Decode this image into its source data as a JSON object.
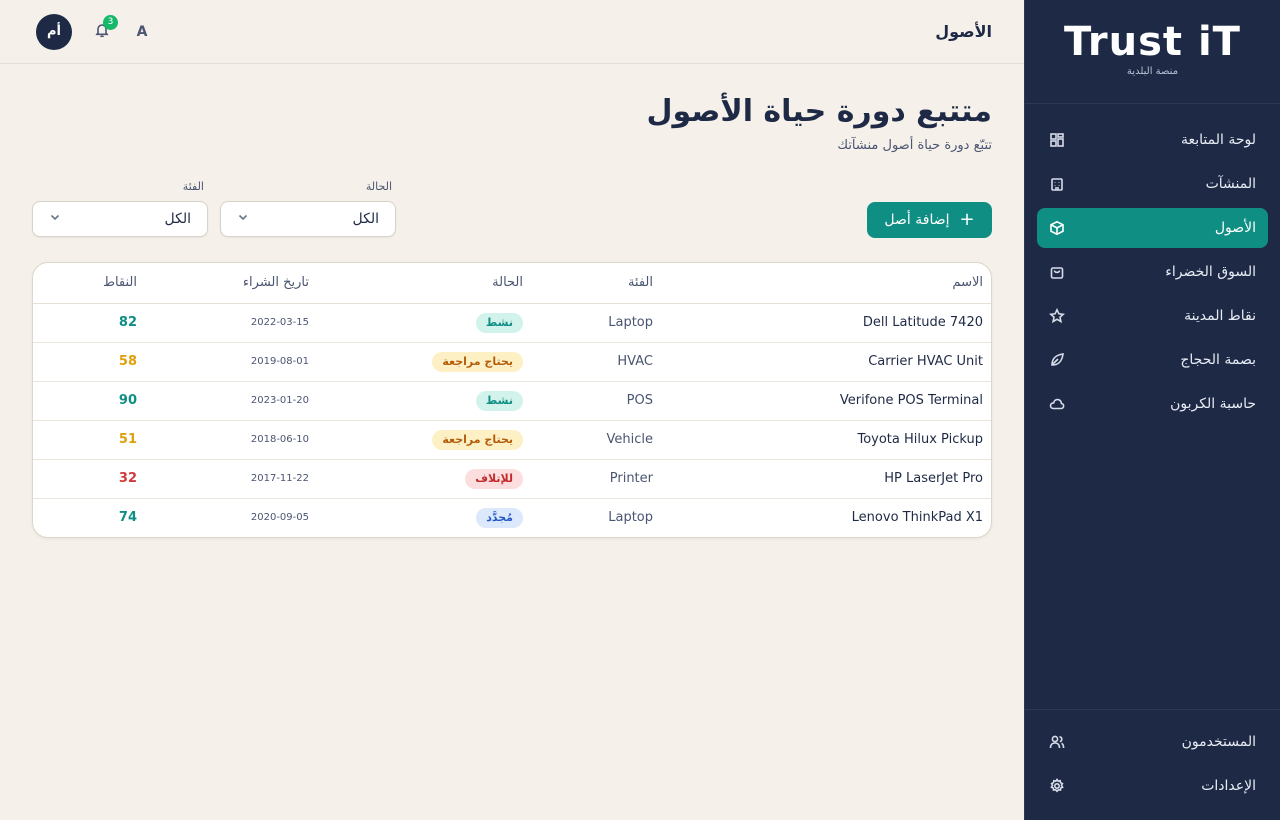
{
  "sidebar": {
    "logo": "Trust iT",
    "subtitle": "منصة البلدية",
    "items": [
      {
        "label": "لوحة المتابعة",
        "icon": "dashboard-icon"
      },
      {
        "label": "المنشآت",
        "icon": "building-icon"
      },
      {
        "label": "الأصول",
        "icon": "box-icon",
        "active": true
      },
      {
        "label": "السوق الخضراء",
        "icon": "shopping-bag-icon"
      },
      {
        "label": "نقاط المدينة",
        "icon": "star-icon"
      },
      {
        "label": "بصمة الحجاج",
        "icon": "leaf-icon"
      },
      {
        "label": "حاسبة الكربون",
        "icon": "cloud-icon"
      }
    ],
    "bottom_items": [
      {
        "label": "المستخدمون",
        "icon": "users-icon"
      },
      {
        "label": "الإعدادات",
        "icon": "gear-icon"
      }
    ]
  },
  "header": {
    "title": "الأصول",
    "avatar_initials": "أم",
    "notification_count": "3",
    "lang_label": "A"
  },
  "main": {
    "title": "متتبع دورة حياة الأصول",
    "subtitle": "تتبّع دورة حياة أصول منشآتك",
    "add_button": "إضافة أصل",
    "filters": {
      "status": {
        "label": "الحالة",
        "value": "الكل"
      },
      "category": {
        "label": "الفئة",
        "value": "الكل"
      }
    },
    "table": {
      "headers": {
        "name": "الاسم",
        "category": "الفئة",
        "status": "الحالة",
        "date": "تاريخ الشراء",
        "points": "النقاط"
      },
      "rows": [
        {
          "name": "Dell Latitude 7420",
          "category": "Laptop",
          "status": "نشط",
          "status_type": "active",
          "date": "2022-03-15",
          "points": "82",
          "points_color": "#0f8f84"
        },
        {
          "name": "Carrier HVAC Unit",
          "category": "HVAC",
          "status": "يحتاج مراجعة",
          "status_type": "review",
          "date": "2019-08-01",
          "points": "58",
          "points_color": "#e0a00b"
        },
        {
          "name": "Verifone POS Terminal",
          "category": "POS",
          "status": "نشط",
          "status_type": "active",
          "date": "2023-01-20",
          "points": "90",
          "points_color": "#0f8f84"
        },
        {
          "name": "Toyota Hilux Pickup",
          "category": "Vehicle",
          "status": "يحتاج مراجعة",
          "status_type": "review",
          "date": "2018-06-10",
          "points": "51",
          "points_color": "#e0a00b"
        },
        {
          "name": "HP LaserJet Pro",
          "category": "Printer",
          "status": "للإتلاف",
          "status_type": "dispose",
          "date": "2017-11-22",
          "points": "32",
          "points_color": "#d13a3a"
        },
        {
          "name": "Lenovo ThinkPad X1",
          "category": "Laptop",
          "status": "مُجدَّد",
          "status_type": "renewed",
          "date": "2020-09-05",
          "points": "74",
          "points_color": "#0f8f84"
        }
      ]
    }
  }
}
